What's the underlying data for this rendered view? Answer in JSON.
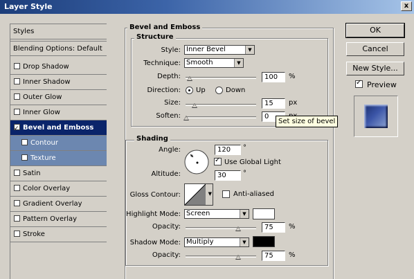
{
  "window": {
    "title": "Layer Style",
    "close_glyph": "x"
  },
  "styles_list": {
    "header": "Styles",
    "blending": "Blending Options: Default",
    "items": [
      {
        "label": "Drop Shadow",
        "checked": false
      },
      {
        "label": "Inner Shadow",
        "checked": false
      },
      {
        "label": "Outer Glow",
        "checked": false
      },
      {
        "label": "Inner Glow",
        "checked": false
      },
      {
        "label": "Bevel and Emboss",
        "checked": true,
        "active": true
      },
      {
        "label": "Contour",
        "checked": false,
        "sub": true
      },
      {
        "label": "Texture",
        "checked": false,
        "sub": true
      },
      {
        "label": "Satin",
        "checked": false
      },
      {
        "label": "Color Overlay",
        "checked": false
      },
      {
        "label": "Gradient Overlay",
        "checked": false
      },
      {
        "label": "Pattern Overlay",
        "checked": false
      },
      {
        "label": "Stroke",
        "checked": false
      }
    ]
  },
  "bevel": {
    "title": "Bevel and Emboss",
    "structure": {
      "title": "Structure",
      "style_label": "Style:",
      "style_value": "Inner Bevel",
      "technique_label": "Technique:",
      "technique_value": "Smooth",
      "depth_label": "Depth:",
      "depth_value": "100",
      "depth_unit": "%",
      "direction_label": "Direction:",
      "direction_up": "Up",
      "direction_down": "Down",
      "direction_selected": "Up",
      "size_label": "Size:",
      "size_value": "15",
      "size_unit": "px",
      "soften_label": "Soften:",
      "soften_value": "0",
      "soften_unit": "px",
      "tooltip": "Set size of bevel"
    },
    "shading": {
      "title": "Shading",
      "angle_label": "Angle:",
      "angle_value": "120",
      "angle_unit": "°",
      "global_light_label": "Use Global Light",
      "global_light": true,
      "altitude_label": "Altitude:",
      "altitude_value": "30",
      "altitude_unit": "°",
      "gloss_label": "Gloss Contour:",
      "antialiased_label": "Anti-aliased",
      "antialiased": false,
      "highlight_label": "Highlight Mode:",
      "highlight_value": "Screen",
      "highlight_color": "#ffffff",
      "hl_opacity_label": "Opacity:",
      "hl_opacity_value": "75",
      "hl_opacity_unit": "%",
      "shadow_label": "Shadow Mode:",
      "shadow_value": "Multiply",
      "shadow_color": "#000000",
      "sh_opacity_label": "Opacity:",
      "sh_opacity_value": "75",
      "sh_opacity_unit": "%"
    }
  },
  "buttons": {
    "ok": "OK",
    "cancel": "Cancel",
    "new_style": "New Style...",
    "preview": "Preview",
    "preview_checked": true
  }
}
